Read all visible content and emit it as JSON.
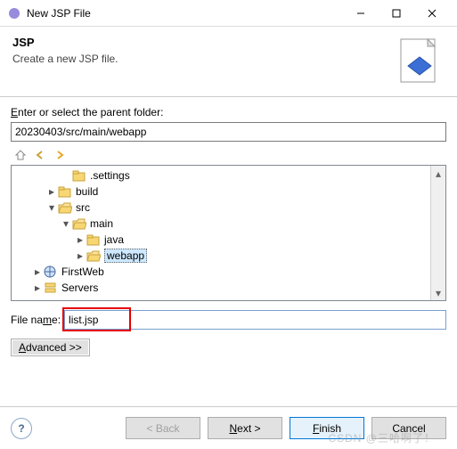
{
  "window": {
    "title": "New JSP File"
  },
  "header": {
    "title": "JSP",
    "subtitle": "Create a new JSP file."
  },
  "labels": {
    "parent_folder": "Enter or select the parent folder:",
    "file_name": "File name:",
    "advanced": "Advanced >>"
  },
  "inputs": {
    "parent_path": "20230403/src/main/webapp",
    "file_name": "list.jsp"
  },
  "tree": [
    {
      "indent": 1,
      "twisty": "",
      "icon": "folder",
      "label": ".settings"
    },
    {
      "indent": 0,
      "twisty": ">",
      "icon": "folder",
      "label": "build"
    },
    {
      "indent": 0,
      "twisty": "v",
      "icon": "folder-open",
      "label": "src"
    },
    {
      "indent": 1,
      "twisty": "v",
      "icon": "folder-open",
      "label": "main"
    },
    {
      "indent": 2,
      "twisty": ">",
      "icon": "folder",
      "label": "java"
    },
    {
      "indent": 2,
      "twisty": ">",
      "icon": "folder-open",
      "label": "webapp",
      "selected": true
    },
    {
      "indent": -1,
      "twisty": ">",
      "icon": "web-project",
      "label": "FirstWeb"
    },
    {
      "indent": -1,
      "twisty": ">",
      "icon": "servers",
      "label": "Servers"
    }
  ],
  "buttons": {
    "back": "< Back",
    "next": "Next >",
    "finish": "Finish",
    "cancel": "Cancel"
  },
  "watermark": "CSDN @三哈啊了！"
}
